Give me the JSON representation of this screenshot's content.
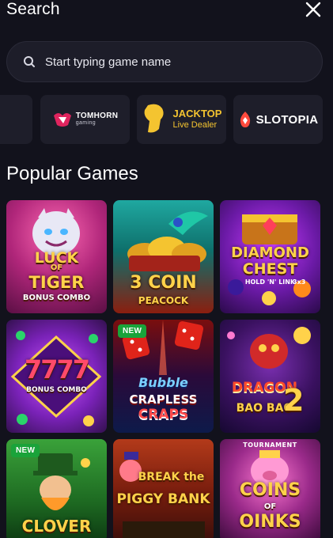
{
  "header": {
    "title": "Search"
  },
  "search": {
    "placeholder": "Start typing game name"
  },
  "providers": [
    {
      "name": "",
      "icon": "provider-logo-partial"
    },
    {
      "name": "TOMHORN",
      "subtitle": "gaming",
      "icon": "tomhorn-logo-icon"
    },
    {
      "name": "JACKTOP",
      "subtitle": "Live Dealer",
      "icon": "jacktop-logo-icon"
    },
    {
      "name": "SLOTOPIA",
      "icon": "slotopia-logo-icon"
    }
  ],
  "section": {
    "title": "Popular Games"
  },
  "games": [
    {
      "line1": "LUCK",
      "line2": "OF",
      "line3": "TIGER",
      "line4": "BONUS COMBO",
      "badge": ""
    },
    {
      "line1": "3 COIN",
      "line2": "PEACOCK",
      "badge": ""
    },
    {
      "line1": "DIAMOND",
      "line2": "CHEST",
      "line3": "HOLD 'N' LINK",
      "line4": "3x3",
      "badge": ""
    },
    {
      "line1": "7777",
      "line2": "BONUS COMBO",
      "badge": ""
    },
    {
      "line1": "Bubble",
      "line2": "CRAPLESS",
      "line3": "CRAPS",
      "badge": "NEW"
    },
    {
      "line1": "DRAGON",
      "line2": "BAO BAO",
      "line3": "2",
      "badge": ""
    },
    {
      "line1": "CLOVER",
      "badge": "NEW"
    },
    {
      "line1": "BREAK the",
      "line2": "PIGGY BANK",
      "badge": ""
    },
    {
      "line1": "TOURNAMENT",
      "line2": "COINS",
      "line3": "OF",
      "line4": "OINKS",
      "badge": ""
    }
  ],
  "colors": {
    "background": "#12121c",
    "card": "#1e1e2a",
    "badge_new": "#1aa33a",
    "accent_gold": "#f4c430"
  }
}
